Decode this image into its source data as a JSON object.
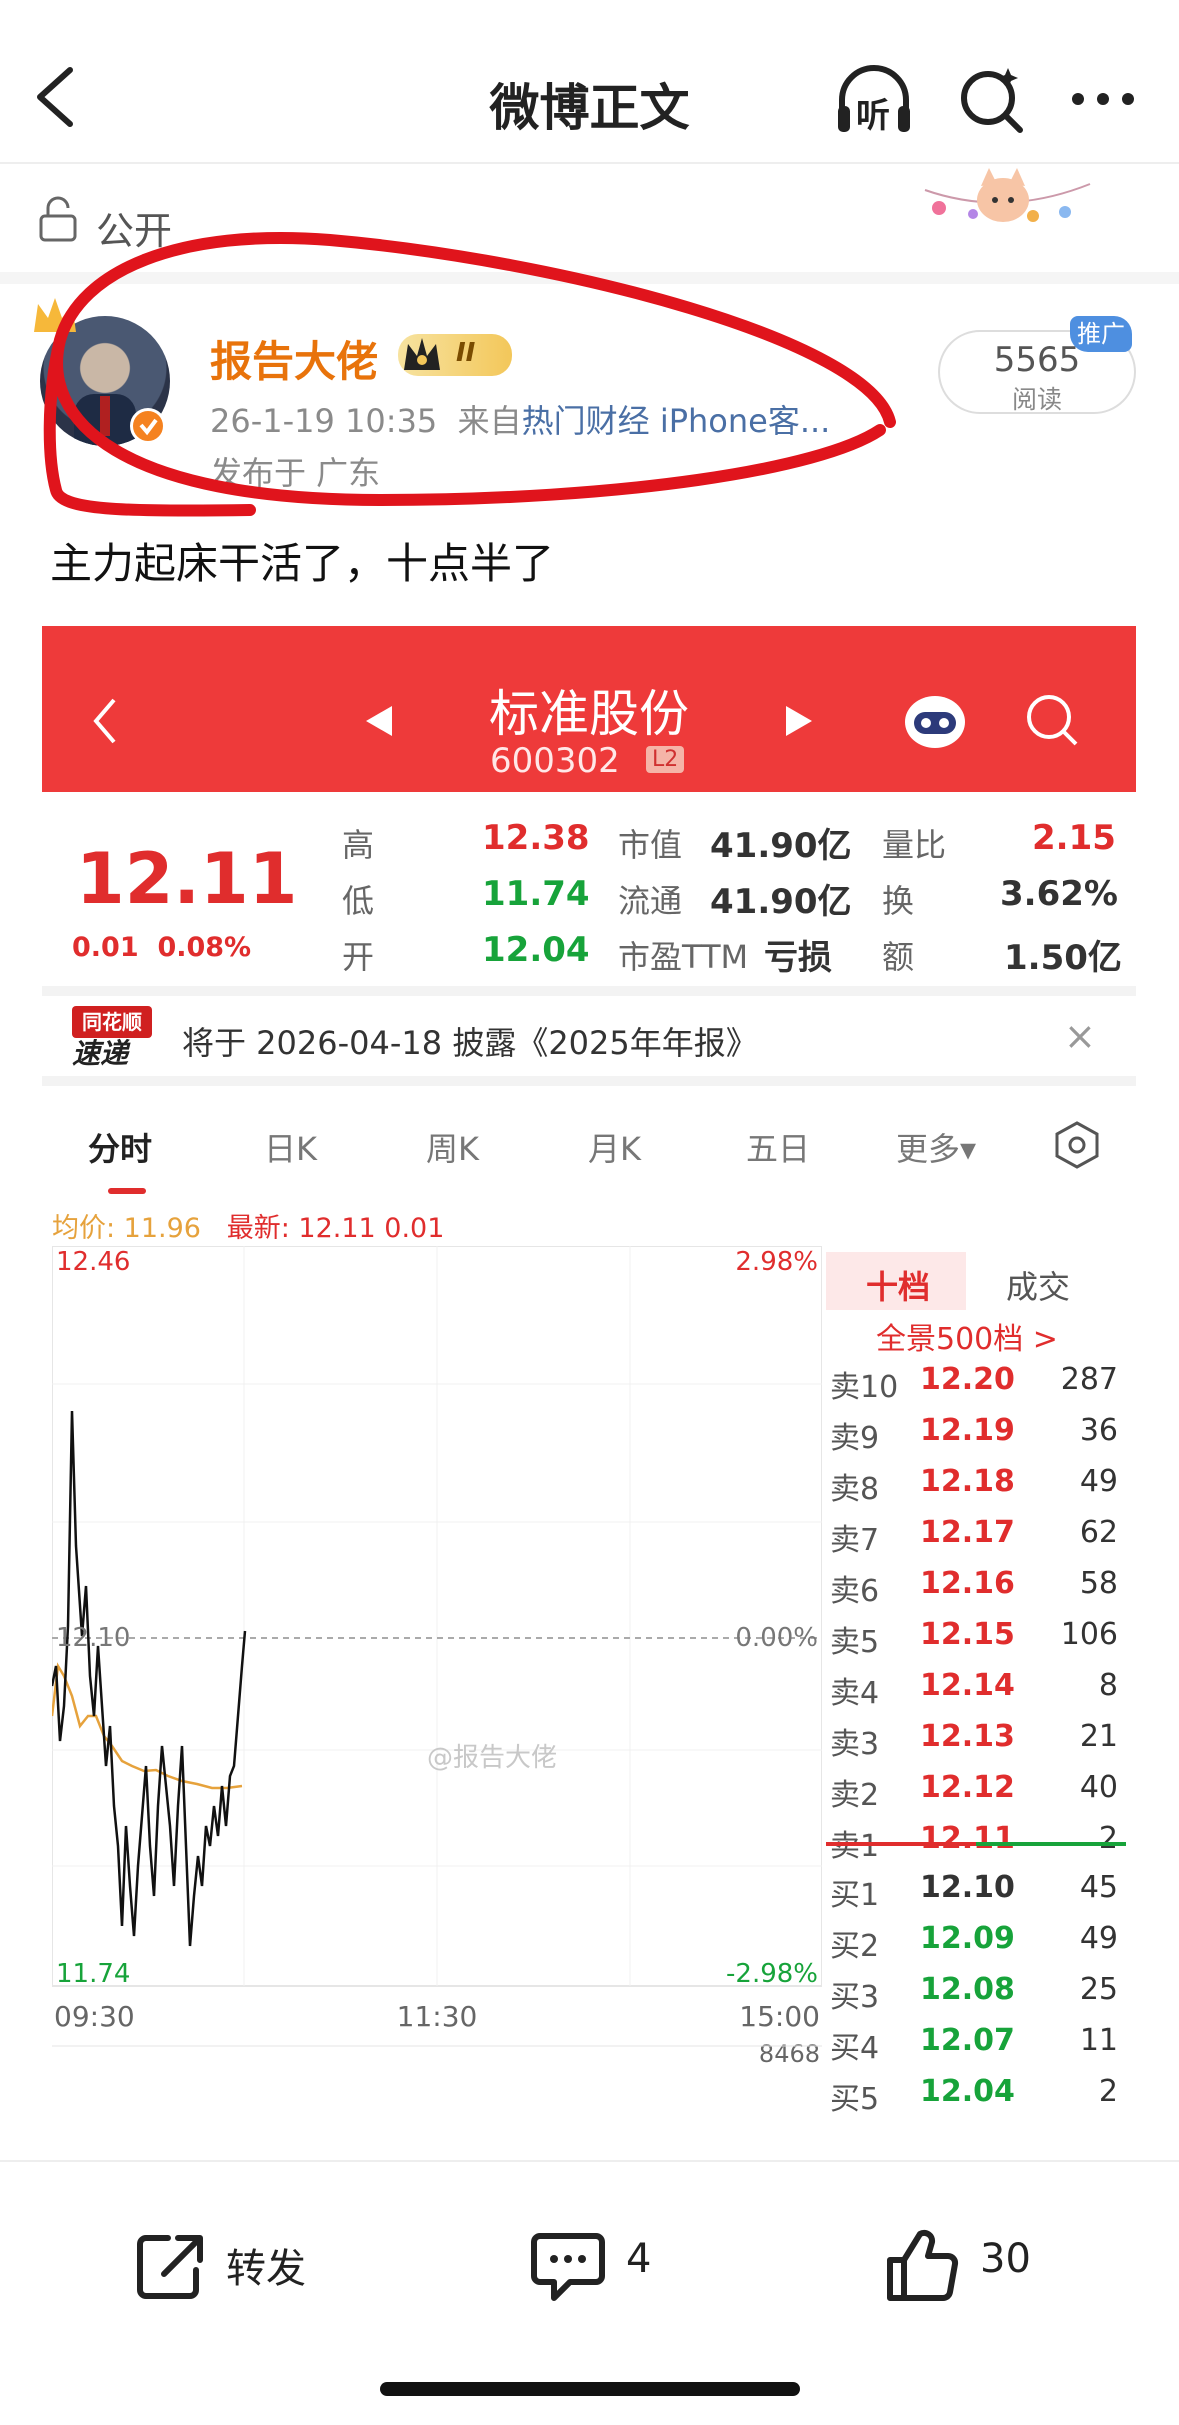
{
  "nav": {
    "title": "微博正文",
    "listen_label": "听"
  },
  "visibility": {
    "label": "公开"
  },
  "post": {
    "author": "报告大佬",
    "vip_level": "II",
    "time": "26-1-19 10:35",
    "source_prefix": "来自",
    "source": "热门财经 iPhone客...",
    "location": "发布于 广东",
    "reads": "5565",
    "reads_label": "阅读",
    "promo_badge": "推广",
    "text": "主力起床干活了，十点半了"
  },
  "stock": {
    "name": "标准股份",
    "code": "600302",
    "level": "L2",
    "price": "12.11",
    "change": "0.01",
    "change_pct": "0.08%",
    "fields": [
      {
        "label": "高",
        "value": "12.38",
        "color": "red"
      },
      {
        "label": "低",
        "value": "11.74",
        "color": "green"
      },
      {
        "label": "开",
        "value": "12.04",
        "color": "green"
      }
    ],
    "fields2": [
      {
        "label": "市值",
        "value": "41.90亿"
      },
      {
        "label": "流通",
        "value": "41.90亿"
      },
      {
        "label": "市盈TTM",
        "value": "亏损"
      }
    ],
    "fields3": [
      {
        "label": "量比",
        "value": "2.15",
        "color": "red"
      },
      {
        "label": "换",
        "value": "3.62%",
        "color": "dark"
      },
      {
        "label": "额",
        "value": "1.50亿",
        "color": "dark"
      }
    ],
    "notice_logo_top": "同花顺",
    "notice_logo_bottom": "速递",
    "notice": "将于 2026-04-18 披露《2025年年报》",
    "tabs": [
      "分时",
      "日K",
      "周K",
      "月K",
      "五日",
      "更多▾"
    ],
    "avg_label": "均价: 11.96",
    "latest_label": "最新: 12.11  0.01",
    "price_high": "12.46",
    "price_low": "11.74",
    "price_mid": "12.10",
    "pct_high": "2.98%",
    "pct_mid": "0.00%",
    "pct_low": "-2.98%",
    "time_start": "09:30",
    "time_mid": "11:30",
    "time_end": "15:00",
    "volume_peek": "8468",
    "watermark": "@报告大佬",
    "book_tab1": "十档",
    "book_tab2": "成交",
    "book_link": "全景500档 >",
    "asks": [
      {
        "k": "卖10",
        "p": "12.20",
        "v": "287"
      },
      {
        "k": "卖9",
        "p": "12.19",
        "v": "36"
      },
      {
        "k": "卖8",
        "p": "12.18",
        "v": "49"
      },
      {
        "k": "卖7",
        "p": "12.17",
        "v": "62"
      },
      {
        "k": "卖6",
        "p": "12.16",
        "v": "58"
      },
      {
        "k": "卖5",
        "p": "12.15",
        "v": "106"
      },
      {
        "k": "卖4",
        "p": "12.14",
        "v": "8"
      },
      {
        "k": "卖3",
        "p": "12.13",
        "v": "21"
      },
      {
        "k": "卖2",
        "p": "12.12",
        "v": "40"
      },
      {
        "k": "卖1",
        "p": "12.11",
        "v": "2"
      }
    ],
    "bids": [
      {
        "k": "买1",
        "p": "12.10",
        "v": "45",
        "color": "dark"
      },
      {
        "k": "买2",
        "p": "12.09",
        "v": "49",
        "color": "green"
      },
      {
        "k": "买3",
        "p": "12.08",
        "v": "25",
        "color": "green"
      },
      {
        "k": "买4",
        "p": "12.07",
        "v": "11",
        "color": "green"
      },
      {
        "k": "买5",
        "p": "12.04",
        "v": "2",
        "color": "green"
      }
    ]
  },
  "actions": {
    "repost": "转发",
    "comments": "4",
    "likes": "30"
  },
  "colors": {
    "accent": "#ee3a3a",
    "up": "#e02d2d",
    "down": "#17a33a",
    "author": "#e8730b"
  }
}
